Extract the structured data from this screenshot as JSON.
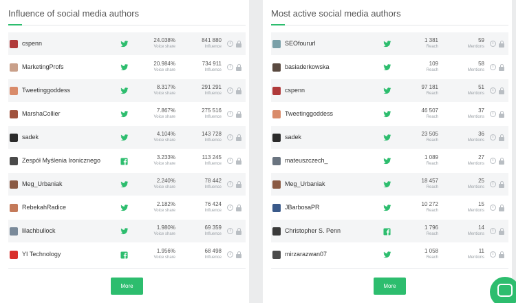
{
  "colors": {
    "accent": "#2dbd6e",
    "twitter": "#2dbd6e",
    "facebook": "#2dbd6e",
    "background": "#ebeced"
  },
  "left": {
    "title": "Influence of social media authors",
    "value_label": "Voice share",
    "second_label": "Influence",
    "more_label": "More",
    "rows": [
      {
        "name": "cspenn",
        "network": "twitter-icon",
        "v1": "24.038%",
        "v2": "841 880",
        "avatar": "#b03a3a"
      },
      {
        "name": "MarketingProfs",
        "network": "twitter-icon",
        "v1": "20.984%",
        "v2": "734 911",
        "avatar": "#c9a08a"
      },
      {
        "name": "Tweetinggoddess",
        "network": "twitter-icon",
        "v1": "8.317%",
        "v2": "291 291",
        "avatar": "#d98b6a"
      },
      {
        "name": "MarshaCollier",
        "network": "twitter-icon",
        "v1": "7.867%",
        "v2": "275 516",
        "avatar": "#a0523d"
      },
      {
        "name": "sadek",
        "network": "twitter-icon",
        "v1": "4.104%",
        "v2": "143 728",
        "avatar": "#2b2b2b"
      },
      {
        "name": "Zespół Myślenia Ironicznego",
        "network": "facebook-icon",
        "v1": "3.233%",
        "v2": "113 245",
        "avatar": "#4a4a4a"
      },
      {
        "name": "Meg_Urbaniak",
        "network": "twitter-icon",
        "v1": "2.240%",
        "v2": "78 442",
        "avatar": "#8a5a44"
      },
      {
        "name": "RebekahRadice",
        "network": "twitter-icon",
        "v1": "2.182%",
        "v2": "76 424",
        "avatar": "#c47a5a"
      },
      {
        "name": "lilachbullock",
        "network": "twitter-icon",
        "v1": "1.980%",
        "v2": "69 359",
        "avatar": "#7a8a9a"
      },
      {
        "name": "YI Technology",
        "network": "facebook-icon",
        "v1": "1.956%",
        "v2": "68 498",
        "avatar": "#d9302c"
      }
    ]
  },
  "right": {
    "title": "Most active social media authors",
    "value_label": "Reach",
    "second_label": "Mentions",
    "more_label": "More",
    "rows": [
      {
        "name": "SEOfoururl",
        "network": "twitter-icon",
        "v1": "1 381",
        "v2": "59",
        "avatar": "#7aa0a8"
      },
      {
        "name": "basiaderkowska",
        "network": "twitter-icon",
        "v1": "109",
        "v2": "58",
        "avatar": "#5a4a40"
      },
      {
        "name": "cspenn",
        "network": "twitter-icon",
        "v1": "97 181",
        "v2": "51",
        "avatar": "#b03a3a"
      },
      {
        "name": "Tweetinggoddess",
        "network": "twitter-icon",
        "v1": "46 507",
        "v2": "37",
        "avatar": "#d98b6a"
      },
      {
        "name": "sadek",
        "network": "twitter-icon",
        "v1": "23 505",
        "v2": "36",
        "avatar": "#2b2b2b"
      },
      {
        "name": "mateuszczech_",
        "network": "twitter-icon",
        "v1": "1 089",
        "v2": "27",
        "avatar": "#6a7480"
      },
      {
        "name": "Meg_Urbaniak",
        "network": "twitter-icon",
        "v1": "18 457",
        "v2": "25",
        "avatar": "#8a5a44"
      },
      {
        "name": "JBarbosaPR",
        "network": "twitter-icon",
        "v1": "10 272",
        "v2": "15",
        "avatar": "#3a5a8a"
      },
      {
        "name": "Christopher S. Penn",
        "network": "facebook-icon",
        "v1": "1 796",
        "v2": "14",
        "avatar": "#3a3a3a"
      },
      {
        "name": "mirzarazwan07",
        "network": "twitter-icon",
        "v1": "1 058",
        "v2": "11",
        "avatar": "#4a4a4a"
      }
    ]
  },
  "chat": {
    "icon": "chat-icon"
  }
}
